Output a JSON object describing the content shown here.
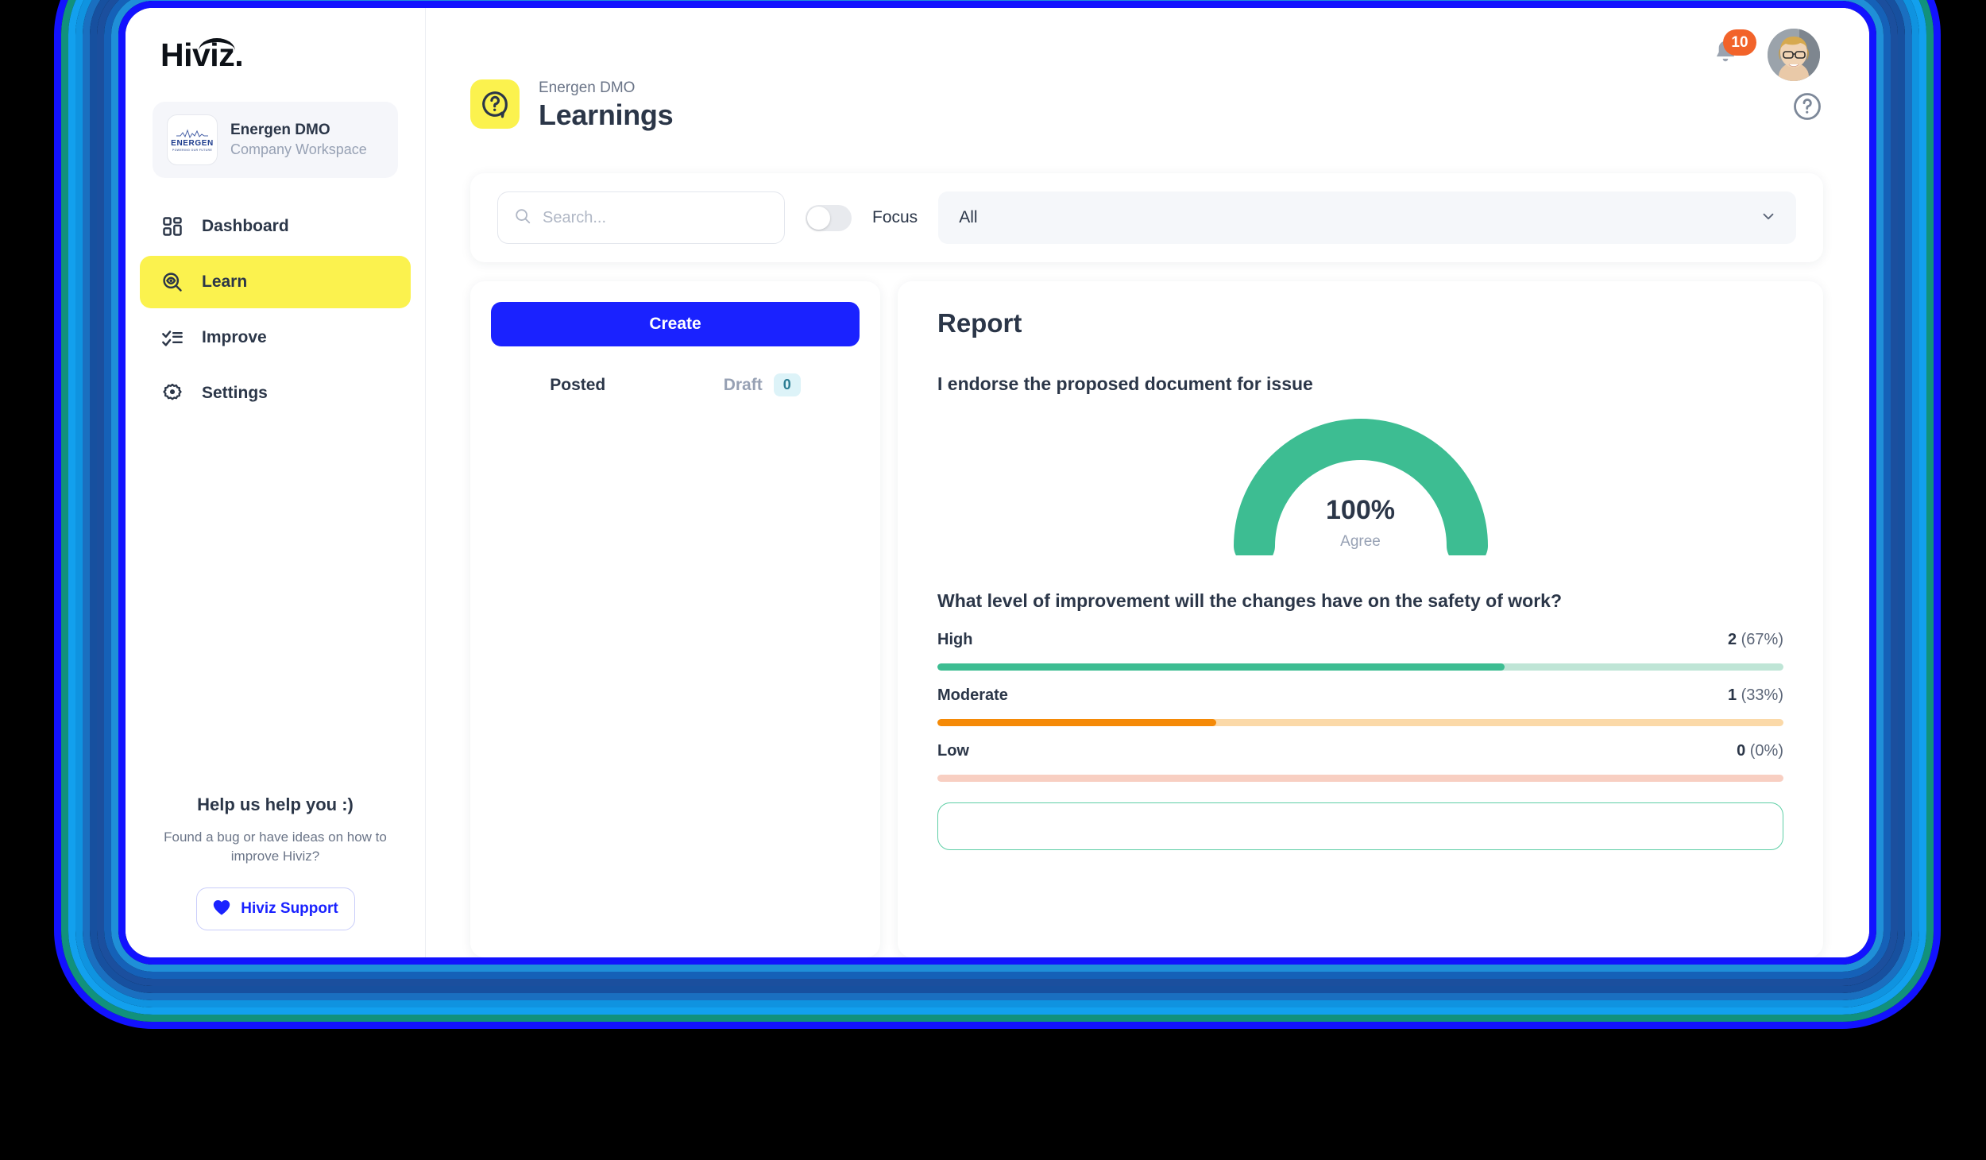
{
  "brand": {
    "name": "Hiviz."
  },
  "workspace": {
    "name": "Energen DMO",
    "subtitle": "Company Workspace",
    "logo_name": "ENERGEN",
    "logo_tagline": "POWERING OUR FUTURE"
  },
  "sidebar": {
    "items": [
      {
        "label": "Dashboard",
        "icon": "grid-icon",
        "active": false
      },
      {
        "label": "Learn",
        "icon": "learn-eye-search-icon",
        "active": true
      },
      {
        "label": "Improve",
        "icon": "checklist-icon",
        "active": false
      },
      {
        "label": "Settings",
        "icon": "gear-icon",
        "active": false
      }
    ],
    "help": {
      "title": "Help us help you :)",
      "description": "Found a bug or have ideas on how to improve Hiviz?",
      "button_label": "Hiviz Support",
      "button_icon": "heart-icon"
    }
  },
  "topbar": {
    "notification_count": "10",
    "bell_icon": "bell-icon",
    "avatar_icon": "user-avatar"
  },
  "header": {
    "eyebrow": "Energen DMO",
    "title": "Learnings",
    "icon": "question-bubble-icon",
    "help_icon": "help-circle-icon"
  },
  "filters": {
    "search_placeholder": "Search...",
    "search_value": "",
    "search_icon": "search-icon",
    "focus_label": "Focus",
    "focus_enabled": false,
    "select_value": "All",
    "select_icon": "chevron-down-icon"
  },
  "list_panel": {
    "create_label": "Create",
    "tabs": [
      {
        "label": "Posted",
        "active": true,
        "badge": null
      },
      {
        "label": "Draft",
        "active": false,
        "badge": "0"
      }
    ]
  },
  "report": {
    "title": "Report",
    "endorsement_question": "I endorse the proposed document for issue",
    "gauge": {
      "value": "100%",
      "caption": "Agree"
    },
    "improvement_question": "What level of improvement will the changes have on the safety of work?"
  },
  "colors": {
    "accent_yellow": "#fbf24e",
    "accent_blue": "#1a22ff",
    "green": "#3dbd92",
    "orange": "#f58a07",
    "red": "#f6a08c",
    "badge_orange": "#f2632a"
  },
  "chart_data": [
    {
      "type": "pie",
      "title": "I endorse the proposed document for issue",
      "categories": [
        "Agree"
      ],
      "values": [
        100
      ],
      "center_label": "100%",
      "sub_label": "Agree",
      "colors": [
        "#3dbd92"
      ]
    },
    {
      "type": "bar",
      "title": "What level of improvement will the changes have on the safety of work?",
      "orientation": "horizontal",
      "categories": [
        "High",
        "Moderate",
        "Low"
      ],
      "values": [
        2,
        1,
        0
      ],
      "percents": [
        67,
        33,
        0
      ],
      "labels": [
        "2 (67%)",
        "1 (33%)",
        "0 (0%)"
      ],
      "colors": [
        "#3dbd92",
        "#f58a07",
        "#f6a08c"
      ],
      "track_colors": [
        "#bfe5d6",
        "#fbd9a8",
        "#f8cfc2"
      ],
      "xlabel": "",
      "ylabel": "",
      "xlim": [
        0,
        100
      ],
      "grid": false,
      "legend": false
    }
  ],
  "rows": [
    {
      "label": "High",
      "count": "2",
      "percent": "(67%)",
      "fill": 67,
      "color": "#3dbd92",
      "track": "#bfe5d6"
    },
    {
      "label": "Moderate",
      "count": "1",
      "percent": "(33%)",
      "fill": 33,
      "color": "#f58a07",
      "track": "#fbd9a8"
    },
    {
      "label": "Low",
      "count": "0",
      "percent": "(0%)",
      "fill": 0,
      "color": "#f6a08c",
      "track": "#f8cfc2"
    }
  ],
  "frame_rings": [
    {
      "color": "#1212ff",
      "inset": 52
    },
    {
      "color": "#1f8fd8",
      "inset": 60
    },
    {
      "color": "#1561b8",
      "inset": 70
    },
    {
      "color": "#1b4f9e",
      "inset": 80
    },
    {
      "color": "#17509f",
      "inset": 90
    },
    {
      "color": "#1a6fc0",
      "inset": 100
    },
    {
      "color": "#0f93e0",
      "inset": 110
    },
    {
      "color": "#12a0ee",
      "inset": 120
    },
    {
      "color": "#11917c",
      "inset": 130
    },
    {
      "color": "#1212ff",
      "inset": 142
    }
  ]
}
